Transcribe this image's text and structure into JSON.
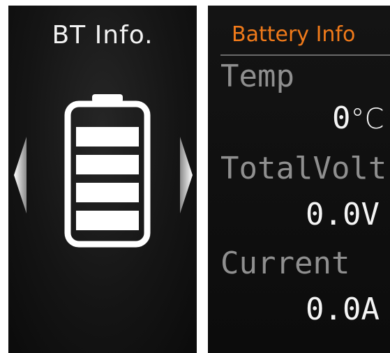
{
  "left_screen": {
    "title": "BT Info.",
    "icon": "battery-full-icon",
    "nav_left_icon": "chevron-left-icon",
    "nav_right_icon": "chevron-right-icon"
  },
  "right_screen": {
    "title": "Battery Info",
    "accent_color": "#f07a1a",
    "rows": [
      {
        "label": "Temp",
        "value": "0",
        "unit": "°C"
      },
      {
        "label": "TotalVolt",
        "value": "0.0V"
      },
      {
        "label": "Current",
        "value": "0.0A"
      }
    ]
  }
}
